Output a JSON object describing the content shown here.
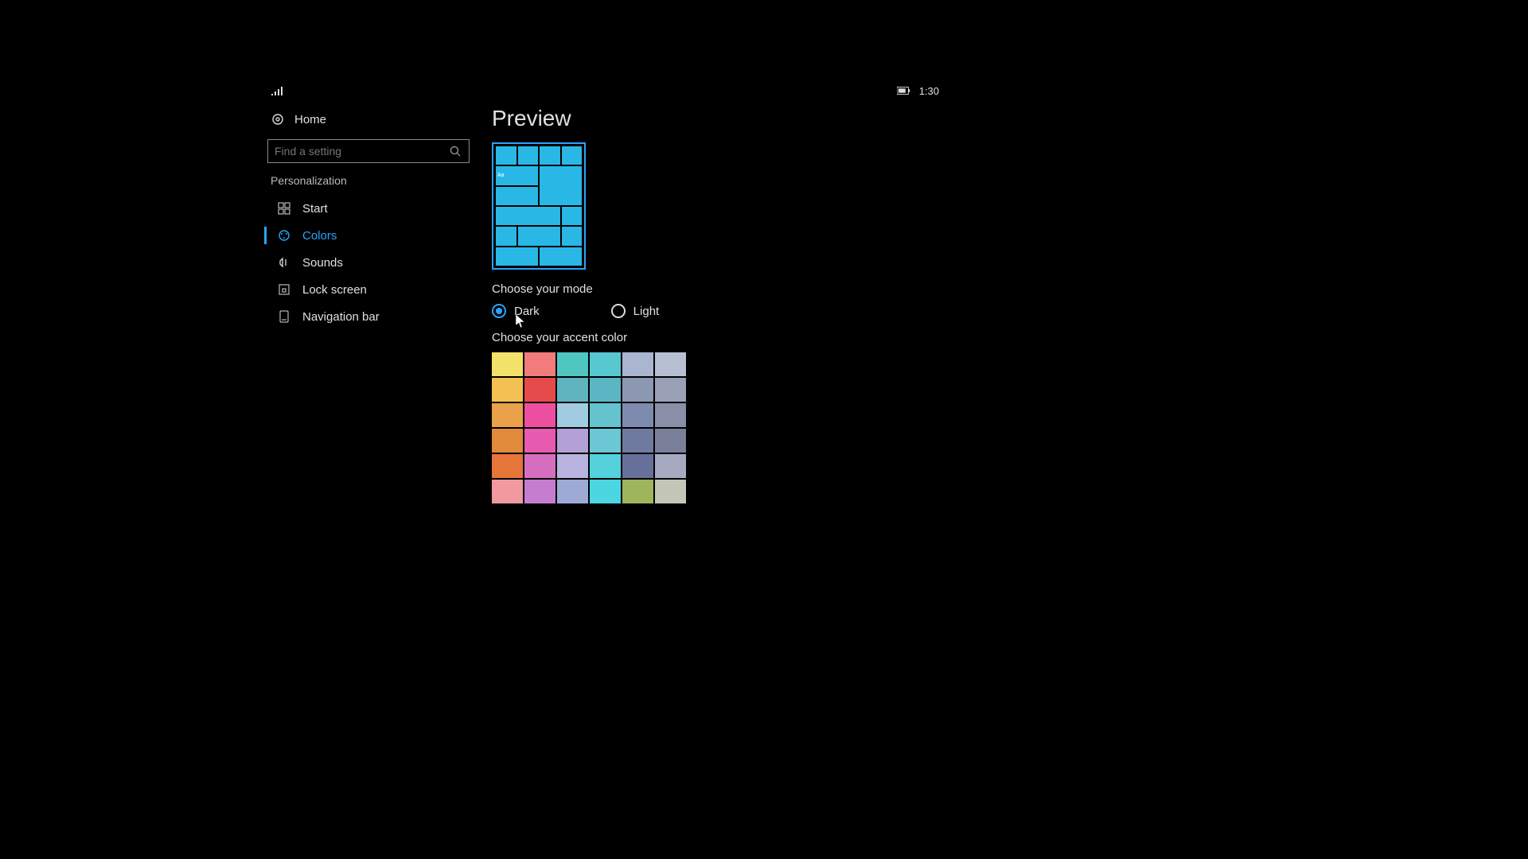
{
  "statusbar": {
    "time": "1:30"
  },
  "sidebar": {
    "home": "Home",
    "search_placeholder": "Find a setting",
    "category": "Personalization",
    "items": [
      {
        "label": "Start",
        "icon": "start-icon"
      },
      {
        "label": "Colors",
        "icon": "colors-icon",
        "active": true
      },
      {
        "label": "Sounds",
        "icon": "sounds-icon"
      },
      {
        "label": "Lock screen",
        "icon": "lock-icon"
      },
      {
        "label": "Navigation bar",
        "icon": "navigation-icon"
      }
    ]
  },
  "main": {
    "preview_title": "Preview",
    "preview_tile_text": "Aa",
    "mode_label": "Choose your mode",
    "modes": {
      "dark": "Dark",
      "light": "Light",
      "selected": "dark"
    },
    "accent_label": "Choose your accent color",
    "accent_colors": [
      [
        "#f5e26a",
        "#f27b7b",
        "#4fc6c0",
        "#57c8d0",
        "#a9b5d1",
        "#b7bfd3"
      ],
      [
        "#f3c153",
        "#e54b4b",
        "#5fb4c0",
        "#5bb6c4",
        "#8d98b2",
        "#9aa0b5"
      ],
      [
        "#e9a24a",
        "#ec4ea0",
        "#a0cbe0",
        "#65c3cf",
        "#7f8aaf",
        "#8a8fa8"
      ],
      [
        "#e08a3c",
        "#e65bb0",
        "#b2a0d6",
        "#6bc7d3",
        "#6f7aa0",
        "#7b809a"
      ],
      [
        "#e6753a",
        "#d66ec0",
        "#b9b3e0",
        "#55d0dd",
        "#67709a",
        "#a6aac0"
      ],
      [
        "#f09aa0",
        "#c57dd0",
        "#9eaad6",
        "#4bd6e2",
        "#9fb55c",
        "#c4c6b8"
      ]
    ]
  }
}
